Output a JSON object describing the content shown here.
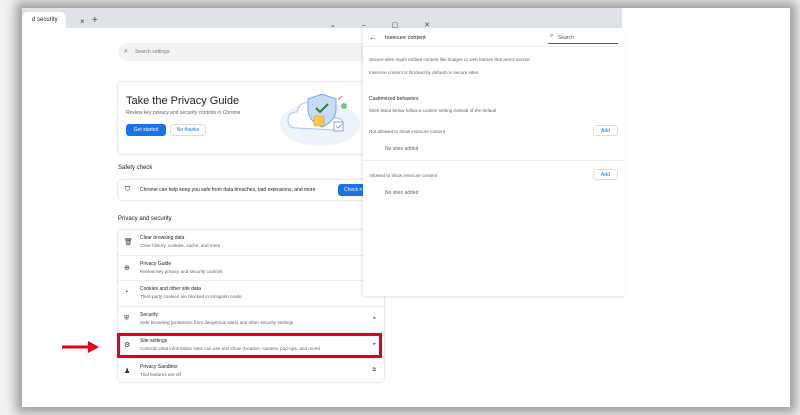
{
  "browser": {
    "tab_title": "d security",
    "tab_close": "×",
    "new_tab": "+",
    "window_controls": "⌄ – ▢ ✕"
  },
  "settings": {
    "search_placeholder": "Search settings",
    "privacy_guide": {
      "title": "Take the Privacy Guide",
      "subtitle": "Review key privacy and security controls in Chrome",
      "primary_button": "Get started",
      "secondary_button": "No thanks"
    },
    "safety_check": {
      "heading": "Safety check",
      "text": "Chrome can help keep you safe from data breaches, bad extensions, and more",
      "button": "Check n"
    },
    "privacy_section": {
      "heading": "Privacy and security",
      "items": [
        {
          "icon": "trash-icon",
          "title": "Clear browsing data",
          "subtitle": "Clear history, cookies, cache, and more",
          "arrow": "▸"
        },
        {
          "icon": "privacy-guide-icon",
          "title": "Privacy Guide",
          "subtitle": "Review key privacy and security controls",
          "arrow": "▸"
        },
        {
          "icon": "cookie-icon",
          "title": "Cookies and other site data",
          "subtitle": "Third-party cookies are blocked in Incognito mode",
          "arrow": "▸"
        },
        {
          "icon": "shield-icon",
          "title": "Security",
          "subtitle": "Safe Browsing (protection from dangerous sites) and other security settings",
          "arrow": "▸"
        },
        {
          "icon": "site-settings-icon",
          "title": "Site settings",
          "subtitle": "Controls what information sites can use and show (location, camera, pop-ups, and more)",
          "arrow": "▸"
        },
        {
          "icon": "sandbox-icon",
          "title": "Privacy Sandbox",
          "subtitle": "Trial features are off",
          "arrow": "⧉"
        }
      ]
    }
  },
  "insecure_panel": {
    "title": "Insecure content",
    "search_placeholder": "Search",
    "description": "Secure sites might embed content like images or web frames that aren't secure",
    "default_note": "Insecure content is blocked by default on secure sites",
    "customized_heading": "Customized behaviors",
    "customized_note": "Sites listed below follow a custom setting instead of the default",
    "not_allowed_heading": "Not allowed to show insecure content",
    "allowed_heading": "Allowed to show insecure content",
    "add_label": "Add",
    "no_sites": "No sites added"
  },
  "colors": {
    "accent": "#1a73e8",
    "highlight": "#e3001b"
  }
}
